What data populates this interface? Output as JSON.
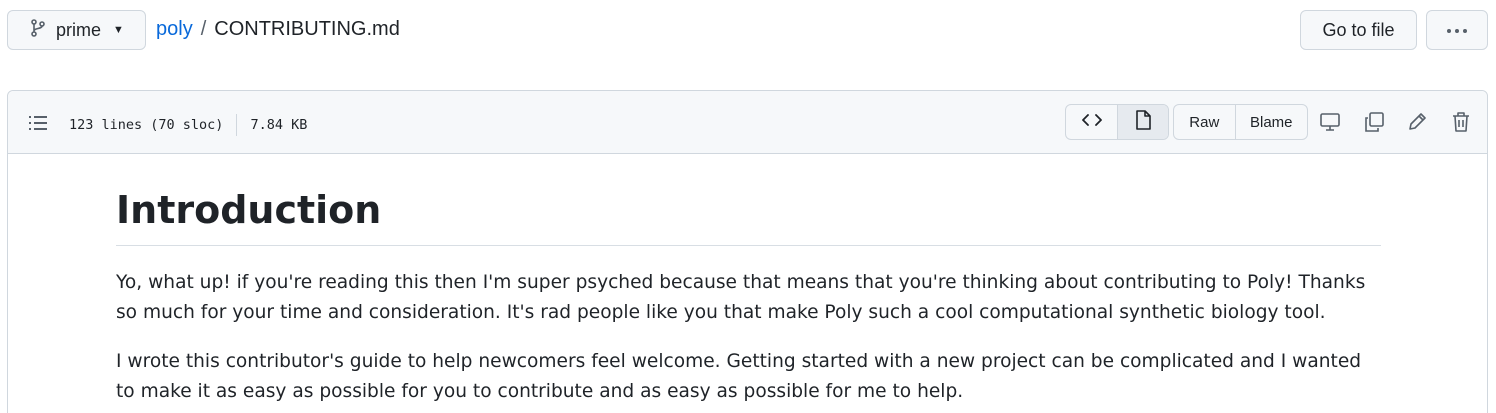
{
  "topbar": {
    "branch": "prime",
    "repo": "poly",
    "separator": "/",
    "file": "CONTRIBUTING.md",
    "go_to_file": "Go to file",
    "more_icon": "kebab-horizontal-icon"
  },
  "file_header": {
    "lines": "123 lines (70 sloc)",
    "size": "7.84 KB",
    "code_icon": "code-icon",
    "preview_icon": "file-icon",
    "raw": "Raw",
    "blame": "Blame",
    "icons": [
      "toc-icon",
      "desktop-icon",
      "copy-icon",
      "pencil-icon",
      "trash-icon"
    ]
  },
  "document": {
    "heading": "Introduction",
    "paragraphs": [
      "Yo, what up! if you're reading this then I'm super psyched because that means that you're thinking about contributing to Poly! Thanks so much for your time and consideration. It's rad people like you that make Poly such a cool computational synthetic biology tool.",
      "I wrote this contributor's guide to help newcomers feel welcome. Getting started with a new project can be complicated and I wanted to make it as easy as possible for you to contribute and as easy as possible for me to help."
    ]
  },
  "colors": {
    "link": "#0969da",
    "border": "#d0d7de",
    "header_bg": "#f6f8fa",
    "text": "#1f2328"
  }
}
